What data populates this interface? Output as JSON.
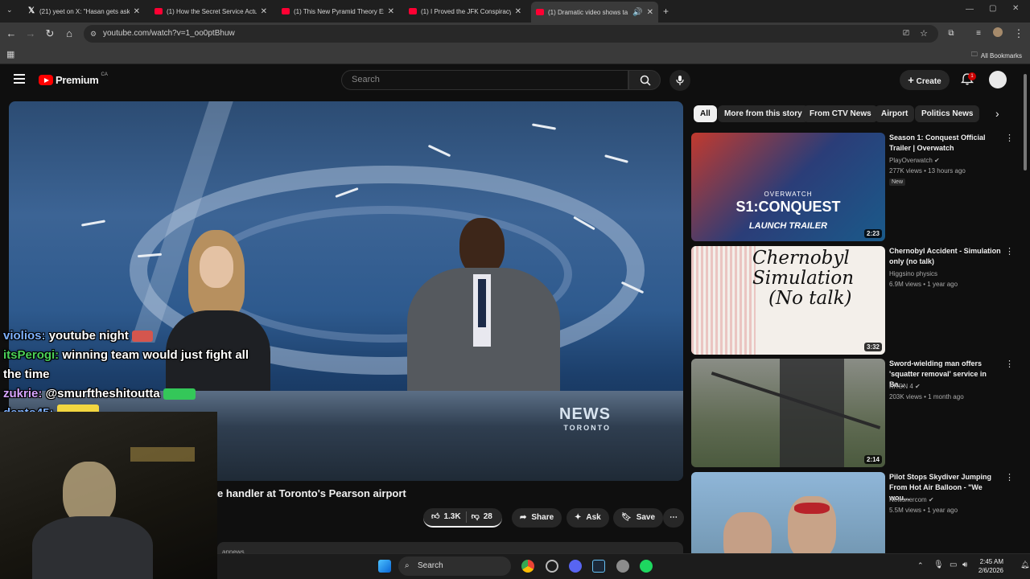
{
  "browser": {
    "tabs": [
      {
        "title": "(21) yeet on X: \"Hasan gets aske",
        "favicon": "x-icon"
      },
      {
        "title": "(1) How the Secret Service Actu",
        "favicon": "youtube-icon"
      },
      {
        "title": "(1) This New Pyramid Theory Ex",
        "favicon": "youtube-icon"
      },
      {
        "title": "(1) I Proved the JFK Conspiracy",
        "favicon": "youtube-icon"
      },
      {
        "title": "(1) Dramatic video shows ta",
        "favicon": "youtube-icon",
        "active": true
      }
    ],
    "url": "youtube.com/watch?v=1_oo0ptBhuw",
    "bookmarks_label": "All Bookmarks"
  },
  "youtube": {
    "logo_text": "Premium",
    "country": "CA",
    "search_placeholder": "Search",
    "create_label": "Create",
    "notification_count": "1"
  },
  "video": {
    "title_visible": "e handler at Toronto's Pearson airport",
    "overlay_brand": "NEWS",
    "overlay_city": "TORONTO",
    "likes": "1.3K",
    "dislikes": "28",
    "share_label": "Share",
    "ask_label": "Ask",
    "save_label": "Save",
    "desc_peek": "annews"
  },
  "chat": [
    {
      "user": "violios:",
      "message": "youtube night",
      "color": "#7fb2ff"
    },
    {
      "user": "itsPerogi:",
      "message": "winning team would just fight all the time",
      "color": "#4bd15a"
    },
    {
      "user": "zukrie:",
      "message": "@smurftheshitoutta",
      "color": "#d8a4ff"
    },
    {
      "user": "dento45:",
      "message": "",
      "color": "#7fb2ff"
    }
  ],
  "chips": [
    "All",
    "More from this story",
    "From CTV News",
    "Airport",
    "Politics News"
  ],
  "recommendations": [
    {
      "title": "Season 1: Conquest Official Trailer | Overwatch",
      "channel": "PlayOverwatch",
      "views": "277K views",
      "age": "13 hours ago",
      "badge": "New",
      "duration": "2:23",
      "thumb_text_1": "OVERWATCH",
      "thumb_text_2": "S1:CONQUEST",
      "thumb_text_3": "LAUNCH TRAILER"
    },
    {
      "title": "Chernobyl Accident - Simulation only (no talk)",
      "channel": "Higgsino physics",
      "views": "6.9M views",
      "age": "1 year ago",
      "duration": "3:32",
      "thumb_text_1": "Chernobyl",
      "thumb_text_2": "Simulation",
      "thumb_text_3": "(No talk)"
    },
    {
      "title": "Sword-wielding man offers 'squatter removal' service in Ba...",
      "channel": "KRON 4",
      "views": "203K views",
      "age": "1 month ago",
      "duration": "2:14"
    },
    {
      "title": "Pilot Stops Skydiver Jumping From Hot Air Balloon - \"We wou...",
      "channel": "Newsnercom",
      "views": "5.5M views",
      "age": "1 year ago"
    }
  ],
  "taskbar": {
    "search_label": "Search",
    "time": "2:45 AM",
    "date": "2/6/2026"
  }
}
